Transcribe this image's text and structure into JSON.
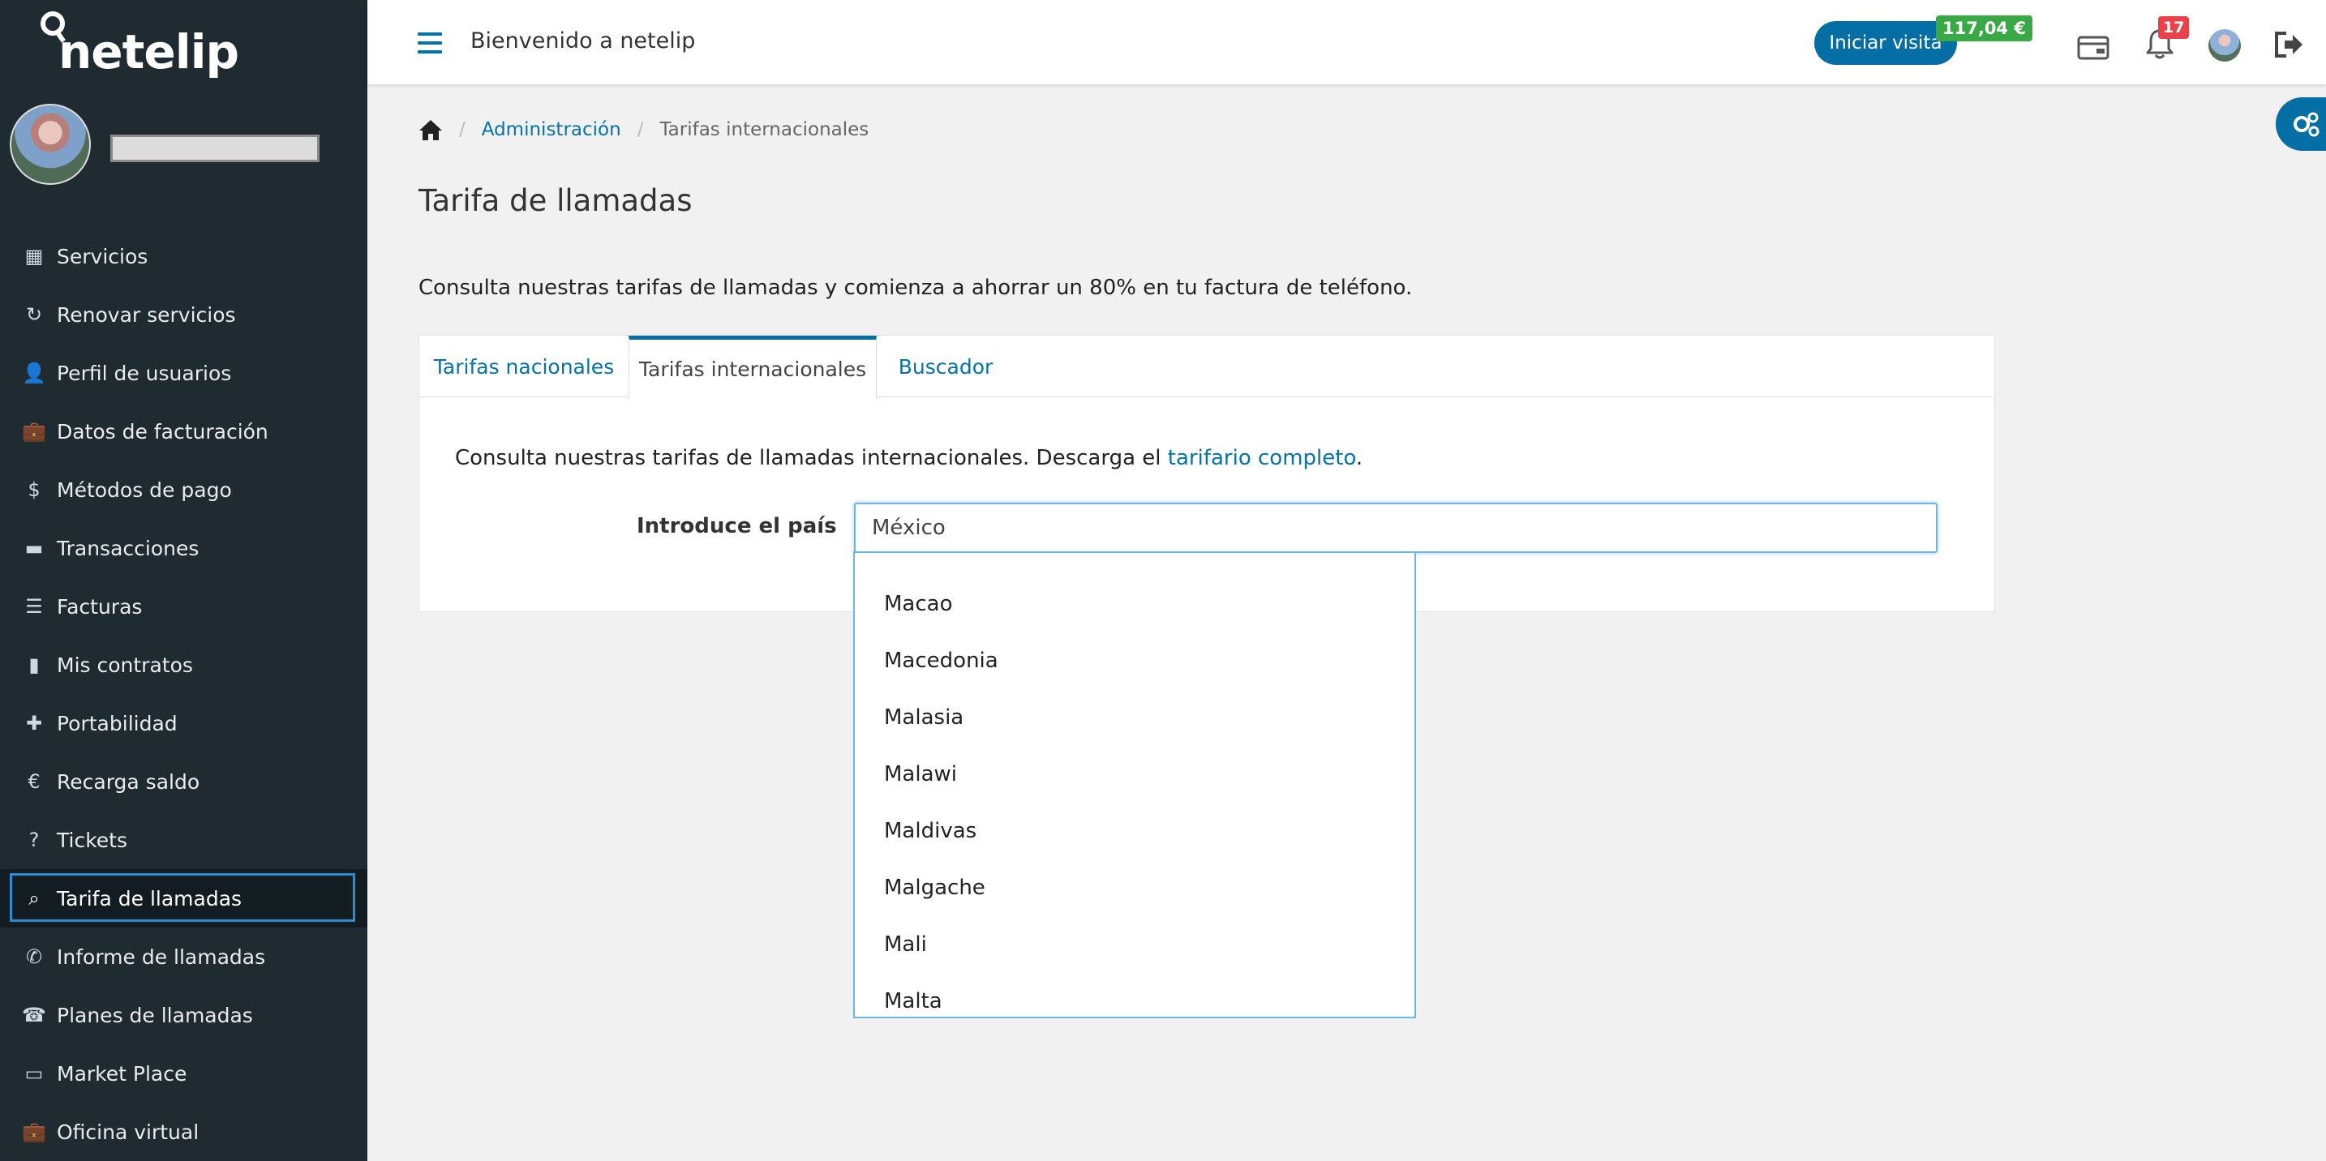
{
  "brand": {
    "name": "netelip"
  },
  "sidebar": {
    "items": [
      {
        "label": "Servicios",
        "icon": "grid-icon",
        "glyph": "▦"
      },
      {
        "label": "Renovar servicios",
        "icon": "refresh-icon",
        "glyph": "↻"
      },
      {
        "label": "Perfil de usuarios",
        "icon": "user-icon",
        "glyph": "👤"
      },
      {
        "label": "Datos de facturación",
        "icon": "briefcase-icon",
        "glyph": "💼"
      },
      {
        "label": "Métodos de pago",
        "icon": "dollar-icon",
        "glyph": "$"
      },
      {
        "label": "Transacciones",
        "icon": "credit-card-icon",
        "glyph": "▬"
      },
      {
        "label": "Facturas",
        "icon": "list-icon",
        "glyph": "☰"
      },
      {
        "label": "Mis contratos",
        "icon": "file-icon",
        "glyph": "▮"
      },
      {
        "label": "Portabilidad",
        "icon": "plus-icon",
        "glyph": "✚"
      },
      {
        "label": "Recarga saldo",
        "icon": "euro-icon",
        "glyph": "€"
      },
      {
        "label": "Tickets",
        "icon": "question-circle-icon",
        "glyph": "?"
      },
      {
        "label": "Tarifa de llamadas",
        "icon": "search-icon",
        "glyph": "⌕",
        "active": true
      },
      {
        "label": "Informe de llamadas",
        "icon": "phone-icon",
        "glyph": "✆"
      },
      {
        "label": "Planes de llamadas",
        "icon": "telephone-icon",
        "glyph": "☎"
      },
      {
        "label": "Market Place",
        "icon": "desktop-icon",
        "glyph": "▭"
      },
      {
        "label": "Oficina virtual",
        "icon": "briefcase-icon",
        "glyph": "💼"
      }
    ]
  },
  "topbar": {
    "welcome": "Bienvenido a netelip",
    "visit_button": "Iniciar visita",
    "balance": "117,04 €",
    "notifications": "17"
  },
  "breadcrumb": {
    "admin": "Administración",
    "current": "Tarifas internacionales"
  },
  "page": {
    "title": "Tarifa de llamadas",
    "intro": "Consulta nuestras tarifas de llamadas y comienza a ahorrar un 80% en tu factura de teléfono."
  },
  "tabs": [
    {
      "label": "Tarifas nacionales"
    },
    {
      "label": "Tarifas internacionales",
      "active": true
    },
    {
      "label": "Buscador"
    }
  ],
  "panel": {
    "text_before": "Consulta nuestras tarifas de llamadas internacionales. Descarga el ",
    "link": "tarifario completo",
    "text_after": ".",
    "country_label": "Introduce el país",
    "country_value": "México"
  },
  "dropdown": {
    "options": [
      "Macao",
      "Macedonia",
      "Malasia",
      "Malawi",
      "Maldivas",
      "Malgache",
      "Mali",
      "Malta"
    ]
  },
  "colors": {
    "accent": "#056ea5",
    "sidebar": "#1f2b31",
    "balance": "#38a945",
    "badge": "#e8424b"
  }
}
